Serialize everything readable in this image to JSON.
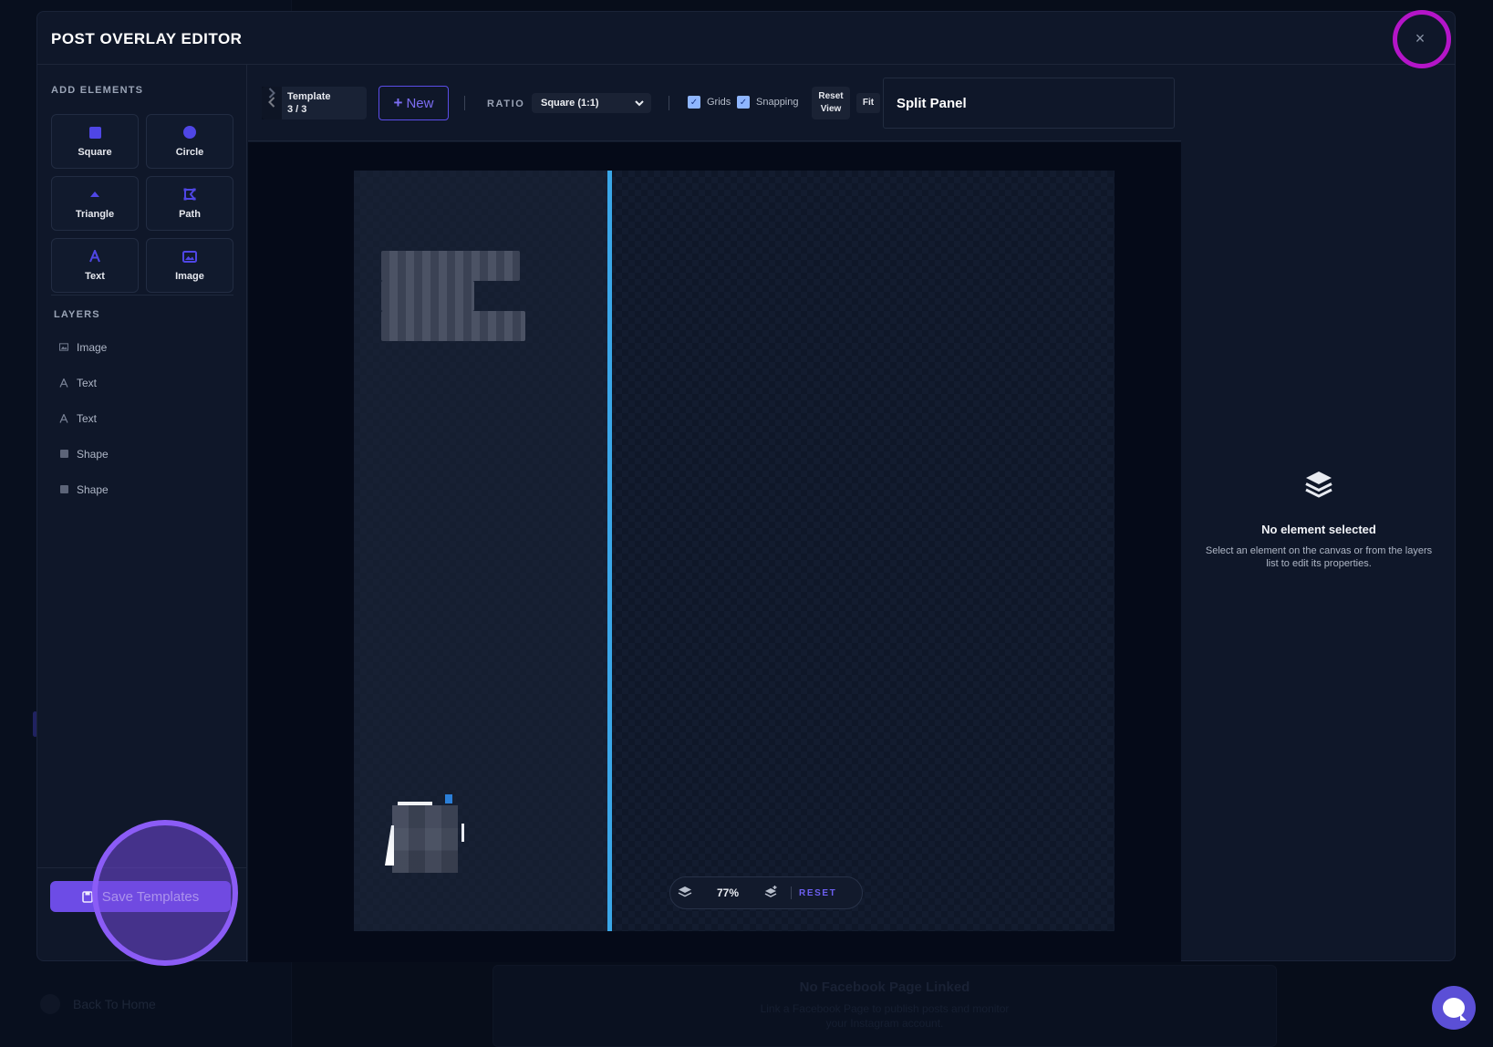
{
  "background": {
    "back_label": "Back To Home",
    "no_page_title": "No Facebook Page Linked",
    "no_page_desc_line1": "Link a Facebook Page to publish posts and monitor",
    "no_page_desc_line2": "your Instagram account."
  },
  "modal": {
    "title": "POST OVERLAY EDITOR",
    "close_glyph": "×"
  },
  "left_panel": {
    "add_elements_label": "ADD ELEMENTS",
    "elements": [
      {
        "label": "Square",
        "icon": "square-icon"
      },
      {
        "label": "Circle",
        "icon": "circle-icon"
      },
      {
        "label": "Triangle",
        "icon": "triangle-icon"
      },
      {
        "label": "Path",
        "icon": "path-icon"
      },
      {
        "label": "Text",
        "icon": "text-icon"
      },
      {
        "label": "Image",
        "icon": "image-icon"
      }
    ],
    "layers_label": "LAYERS",
    "layers": [
      {
        "label": "Image",
        "icon": "image-icon"
      },
      {
        "label": "Text",
        "icon": "text-icon"
      },
      {
        "label": "Text",
        "icon": "text-icon"
      },
      {
        "label": "Shape",
        "icon": "shape-icon"
      },
      {
        "label": "Shape",
        "icon": "shape-icon"
      }
    ],
    "save_label": "Save Templates"
  },
  "toolbar": {
    "template_label": "Template",
    "template_count": "3 / 3",
    "new_label": "New",
    "ratio_label": "RATIO",
    "ratio_value": "Square (1:1)",
    "grids_label": "Grids",
    "snapping_label": "Snapping",
    "reset_view_line1": "Reset",
    "reset_view_line2": "View",
    "fit_label": "Fit",
    "template_name": "Split Panel"
  },
  "canvas": {
    "zoom": "77%",
    "reset_label": "RESET",
    "accent_color": "#3aa7e8"
  },
  "right_panel": {
    "empty_title": "No element selected",
    "empty_desc": "Select an element on the canvas or from the layers list to edit its properties."
  },
  "colors": {
    "primary": "#5b4de8",
    "highlight_ring": "#b415c8",
    "save_button": "#6d4ce6"
  }
}
